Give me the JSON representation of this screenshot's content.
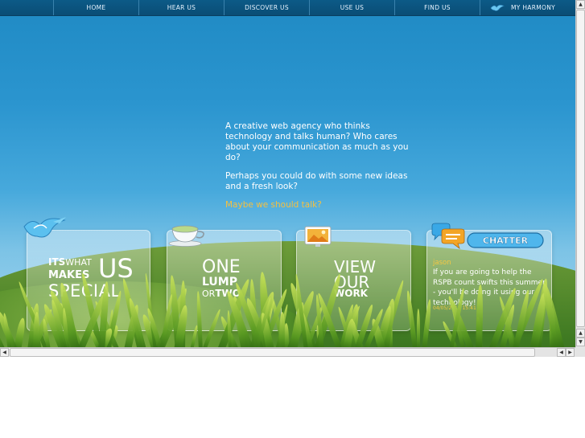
{
  "nav": {
    "items": [
      "HOME",
      "HEAR US",
      "DISCOVER US",
      "USE US",
      "FIND US",
      "MY HARMONY"
    ]
  },
  "intro": {
    "p1": "A creative web agency who thinks technology and talks human? Who cares about your communication as much as you do?",
    "p2": "Perhaps you could do with some new ideas and a fresh look?",
    "cta": "Maybe we should talk?"
  },
  "panels": {
    "special": {
      "its": "ITS",
      "what": "WHAT",
      "makes": "MAKES",
      "us": "US",
      "special": "SPECIAL"
    },
    "lump": {
      "one": "ONE",
      "lump": "LUMP",
      "or": "OR",
      "two": "TWO"
    },
    "work": {
      "view": "VIEW",
      "our": "OUR",
      "work": "WORK"
    },
    "chatter": {
      "logo": "CHATTER",
      "name": "jason",
      "message": "If you are going to help the RSPB count swifts this summer - you'll be doing it using our technology!",
      "time": "04/05/2011 15:41"
    }
  },
  "colors": {
    "nav_bg": "#0a4d75",
    "sky": "#2b95cf",
    "accent": "#f5c040"
  },
  "icons": [
    "bird-logo-icon",
    "teacup-icon",
    "picture-frame-icon",
    "speech-bubbles-icon"
  ]
}
